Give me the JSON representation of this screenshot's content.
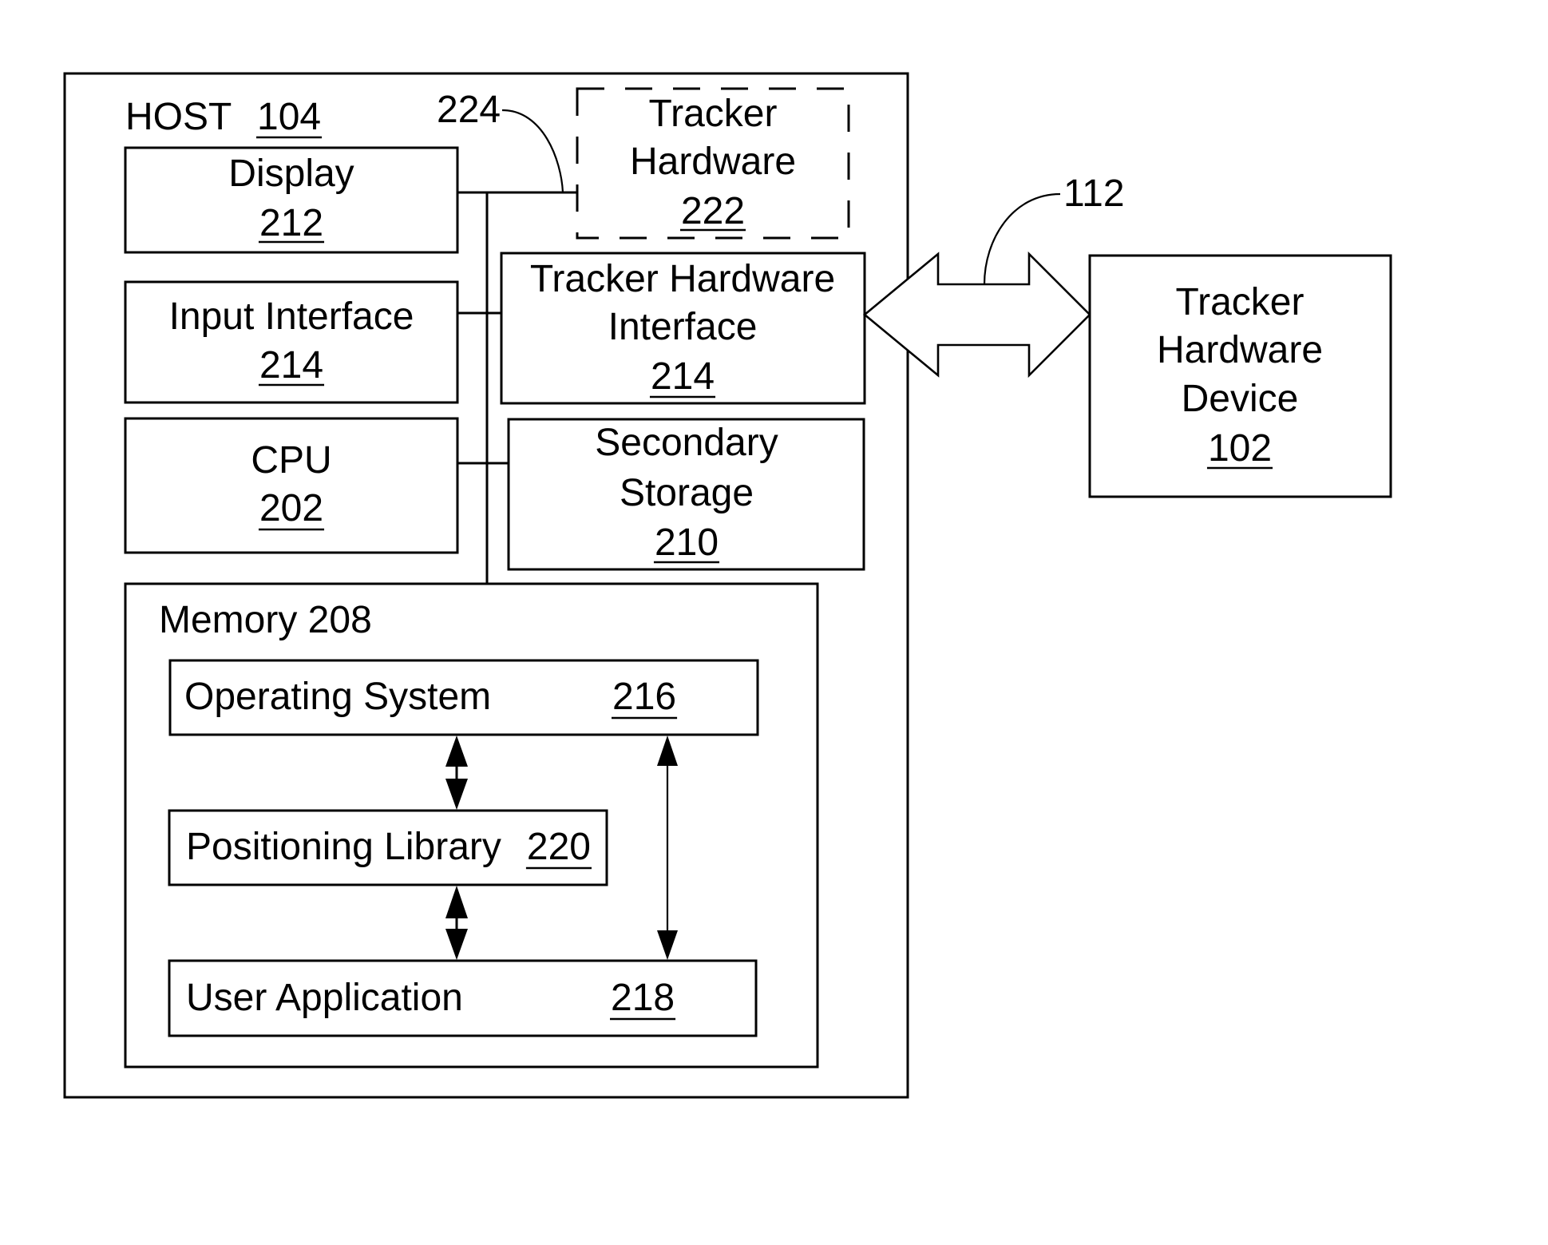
{
  "figure": {
    "title": "Host and tracker hardware system block diagram",
    "colors": {
      "stroke": "#000000",
      "background": "#ffffff"
    }
  },
  "host": {
    "label": "HOST",
    "ref": "104",
    "boxes": {
      "display": {
        "lines": [
          "Display"
        ],
        "ref": "212"
      },
      "input_interface": {
        "lines": [
          "Input Interface"
        ],
        "ref": "214"
      },
      "cpu": {
        "lines": [
          "CPU"
        ],
        "ref": "202"
      },
      "tracker_hardware": {
        "lines": [
          "Tracker",
          "Hardware"
        ],
        "ref": "222",
        "style": "dashed (optional)"
      },
      "tracker_hardware_interface": {
        "lines": [
          "Tracker Hardware",
          "Interface"
        ],
        "ref": "214"
      },
      "secondary_storage": {
        "lines": [
          "Secondary",
          "Storage"
        ],
        "ref": "210"
      }
    },
    "bus_ref": "224",
    "memory": {
      "label": "Memory 208",
      "items": {
        "operating_system": {
          "label": "Operating System",
          "ref": "216"
        },
        "positioning_library": {
          "label": "Positioning Library",
          "ref": "220"
        },
        "user_application": {
          "label": "User Application",
          "ref": "218"
        }
      },
      "links": [
        {
          "from": "Operating System",
          "to": "Positioning Library",
          "direction": "bidirectional"
        },
        {
          "from": "Positioning Library",
          "to": "User Application",
          "direction": "bidirectional"
        },
        {
          "from": "Operating System",
          "to": "User Application",
          "direction": "bidirectional"
        }
      ]
    }
  },
  "connection": {
    "ref": "112",
    "from": "Tracker Hardware Interface 214",
    "to": "Tracker Hardware Device 102",
    "direction": "bidirectional"
  },
  "device": {
    "lines": [
      "Tracker",
      "Hardware",
      "Device"
    ],
    "ref": "102"
  }
}
